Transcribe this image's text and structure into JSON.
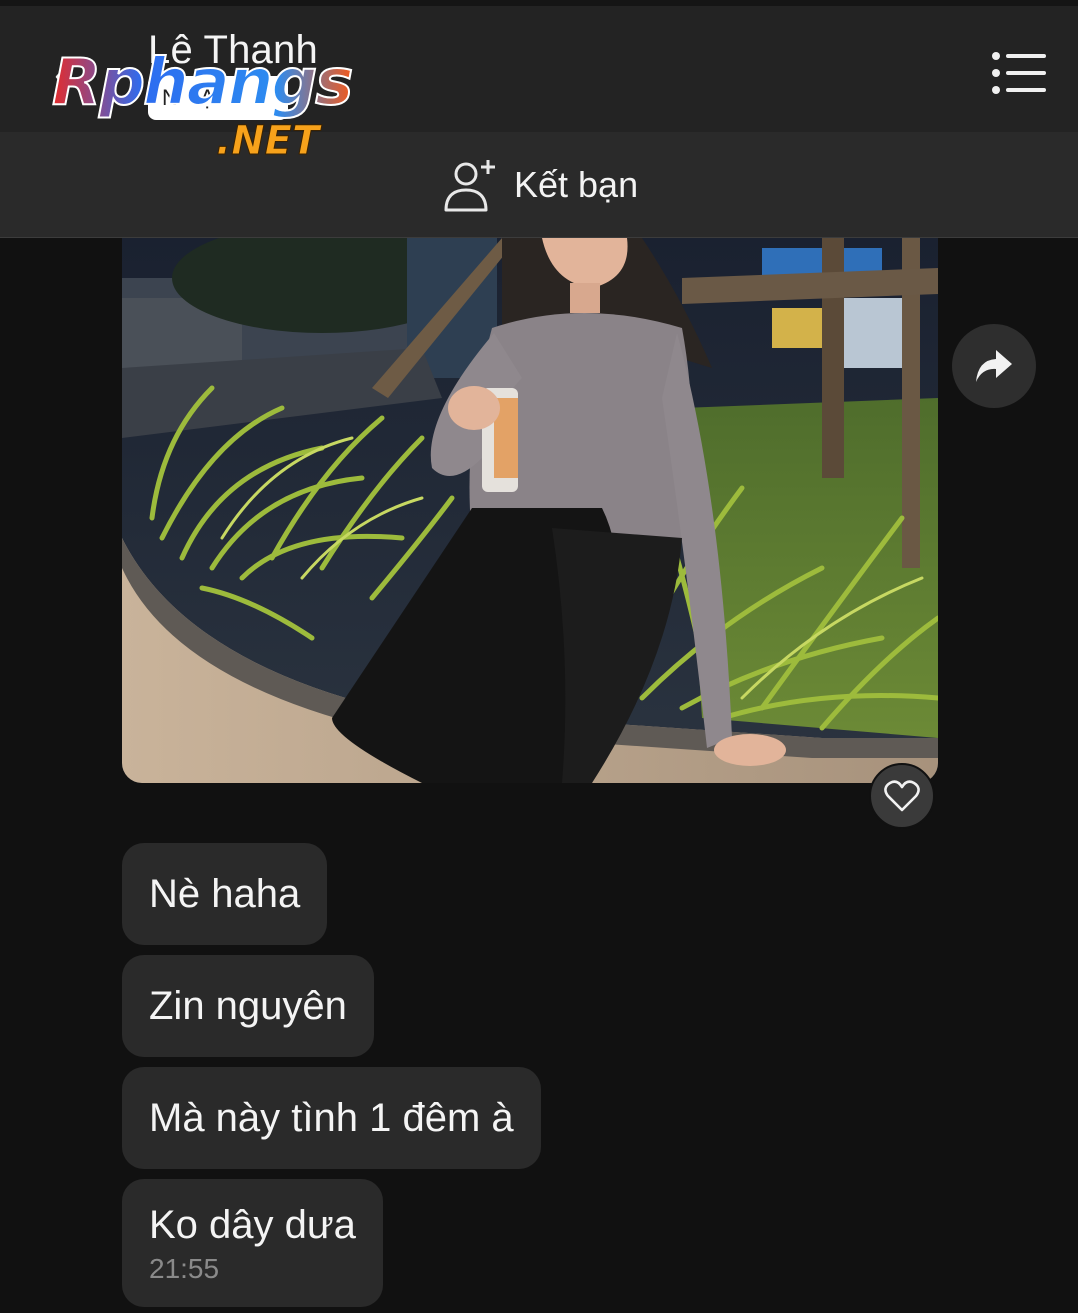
{
  "header": {
    "back_icon": "chevron-left-icon",
    "contact_name": "Lê Thanh",
    "contact_status": "N  Ạ",
    "menu_icon": "list-menu-icon"
  },
  "friend_bar": {
    "icon": "add-user-icon",
    "label": "Kết bạn"
  },
  "watermark": {
    "line1": "Rphangs",
    "line2": ".NET"
  },
  "chat": {
    "photo": {
      "description_icon": "photo-message"
    },
    "share_icon": "forward-share-icon",
    "reaction_icon": "heart-outline-icon",
    "messages": [
      {
        "text": "Nè haha"
      },
      {
        "text": "Zin nguyên"
      },
      {
        "text": "Mà này tình 1 đêm à"
      },
      {
        "text": "Ko dây dưa",
        "time": "21:55"
      }
    ]
  },
  "colors": {
    "background": "#111111",
    "header": "#232323",
    "bubble": "#2a2a2a",
    "text": "#f4f4f4",
    "muted": "#8a8a8a"
  }
}
